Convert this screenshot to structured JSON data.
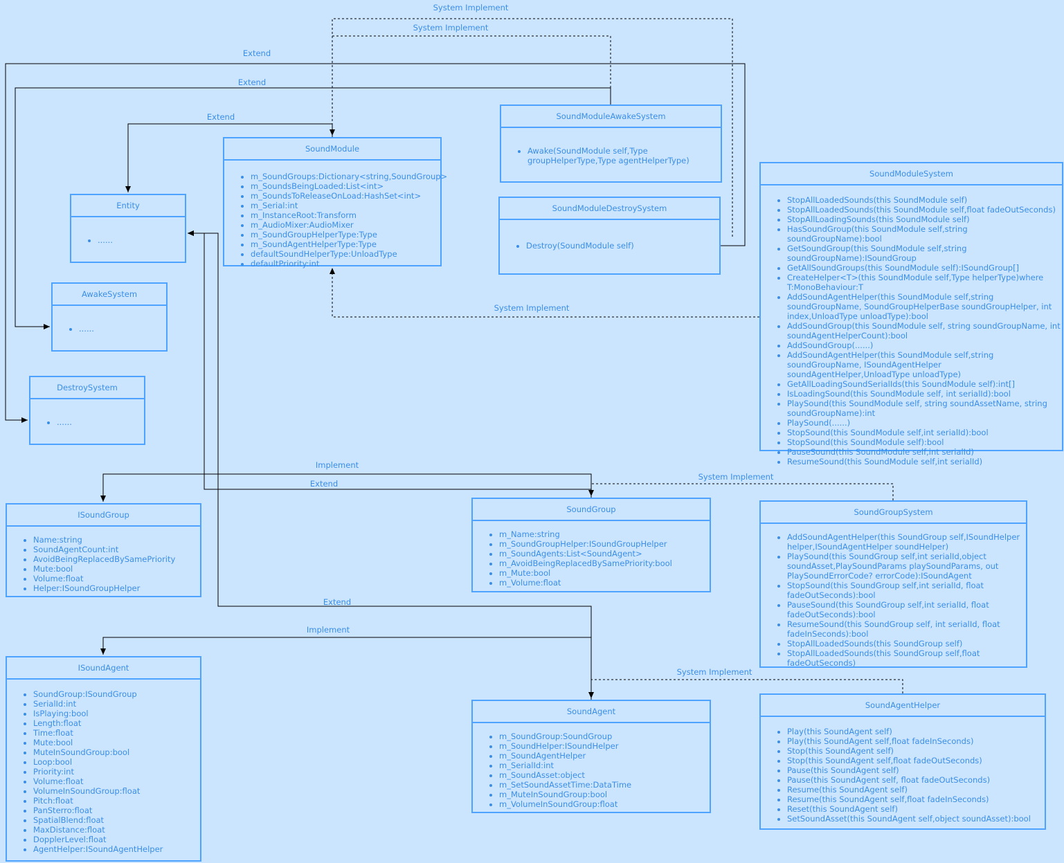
{
  "colors": {
    "background": "#cce5ff",
    "border": "#4da3ff",
    "text": "#3a8ee6",
    "line": "#000000"
  },
  "labels": {
    "destroy_sys_impl": "System Implement",
    "awake_sys_impl": "System Implement",
    "destroy_extend": "Extend",
    "awake_extend": "Extend",
    "module_extend": "Extend",
    "module_sys_impl": "System Implement",
    "group_implement": "Implement",
    "group_extend": "Extend",
    "group_sys_impl": "System Implement",
    "agent_extend": "Extend",
    "agent_implement": "Implement",
    "agent_sys_impl": "System Implement"
  },
  "classes": {
    "sound_module": {
      "title": "SoundModule",
      "items": [
        "m_SoundGroups:Dictionary<string,SoundGroup>",
        "m_SoundsBeingLoaded:List<int>",
        "m_SoundsToReleaseOnLoad:HashSet<int>",
        "m_Serial:int",
        "m_InstanceRoot:Transform",
        "m_AudioMixer:AudioMixer",
        "m_SoundGroupHelperType:Type",
        "m_SoundAgentHelperType:Type",
        "defaultSoundHelperType:UnloadType",
        "defaultPriority:int"
      ]
    },
    "entity": {
      "title": "Entity",
      "items": [
        "......"
      ]
    },
    "awake_system": {
      "title": "AwakeSystem",
      "items": [
        "......"
      ]
    },
    "destroy_system": {
      "title": "DestroySystem",
      "items": [
        "......"
      ]
    },
    "sound_module_awake_system": {
      "title": "SoundModuleAwakeSystem",
      "items": [
        "Awake(SoundModule self,Type groupHelperType,Type agentHelperType)"
      ]
    },
    "sound_module_destroy_system": {
      "title": "SoundModuleDestroySystem",
      "items": [
        "Destroy(SoundModule self)"
      ]
    },
    "sound_module_system": {
      "title": "SoundModuleSystem",
      "items": [
        "StopAllLoadedSounds(this SoundModule self)",
        "StopAllLoadedSounds(this SoundModule self,float fadeOutSeconds)",
        "StopAllLoadingSounds(this SoundModule self)",
        "HasSoundGroup(this SoundModule self,string soundGroupName):bool",
        "GetSoundGroup(this SoundModule self,string soundGroupName):ISoundGroup",
        "GetAllSoundGroups(this SoundModule self):ISoundGroup[]",
        "CreateHelper<T>(this SoundModule self,Type helperType)where T:MonoBehaviour:T",
        "AddSoundAgentHelper(this SoundModule self,string soundGroupName, SoundGroupHelperBase soundGroupHelper, int index,UnloadType unloadType):bool",
        "AddSoundGroup(this SoundModule self, string soundGroupName, int soundAgentHelperCount):bool",
        "AddSoundGroup(......)",
        "AddSoundAgentHelper(this SoundModule self,string soundGroupName, ISoundAgentHelper soundAgentHelper,UnloadType unloadType)",
        "GetAllLoadingSoundSerialIds(this SoundModule self):int[]",
        "IsLoadingSound(this SoundModule self, int serialId):bool",
        "PlaySound(this SoundModule self, string soundAssetName, string soundGroupName):int",
        "PlaySound(......)",
        "StopSound(this SoundModule self,int serialId):bool",
        "StopSound(this SoundModule self):bool",
        "PauseSound(this SoundModule self,int serialId)",
        "ResumeSound(this SoundModule self,int serialId)"
      ]
    },
    "isound_group": {
      "title": "ISoundGroup",
      "items": [
        "Name:string",
        "SoundAgentCount:int",
        "AvoidBeingReplacedBySamePriority",
        "Mute:bool",
        "Volume:float",
        "Helper:ISoundGroupHelper"
      ]
    },
    "sound_group": {
      "title": "SoundGroup",
      "items": [
        "m_Name:string",
        "m_SoundGroupHelper:ISoundGroupHelper",
        "m_SoundAgents:List<SoundAgent>",
        "m_AvoidBeingReplacedBySamePriority:bool",
        "m_Mute:bool",
        "m_Volume:float"
      ]
    },
    "sound_group_system": {
      "title": "SoundGroupSystem",
      "items": [
        "AddSoundAgentHelper(this SoundGroup self,ISoundHelper helper,ISoundAgentHelper soundHelper)",
        "PlaySound(this SoundGroup self,int serialId,object soundAsset,PlaySoundParams playSoundParams, out PlaySoundErrorCode? errorCode):ISoundAgent",
        "StopSound(this SoundGroup self,int serialId, float fadeOutSeconds):bool",
        "PauseSound(this SoundGroup self,int serialId, float fadeOutSeconds):bool",
        "ResumeSound(this SoundGroup self, int serialId, float fadeInSeconds):bool",
        "StopAllLoadedSounds(this SoundGroup self)",
        "StopAllLoadedSounds(this SoundGroup self,float fadeOutSeconds)"
      ]
    },
    "isound_agent": {
      "title": "ISoundAgent",
      "items": [
        "SoundGroup:ISoundGroup",
        "SerialId:int",
        "IsPlaying:bool",
        "Length:float",
        "Time:float",
        "Mute:bool",
        "MuteInSoundGroup:bool",
        "Loop:bool",
        "Priority:int",
        "Volume:float",
        "VolumeInSoundGroup:float",
        "Pitch:float",
        "PanSterro:float",
        "SpatialBlend:float",
        "MaxDistance:float",
        "DopplerLevel:float",
        "AgentHelper:ISoundAgentHelper"
      ]
    },
    "sound_agent": {
      "title": "SoundAgent",
      "items": [
        "m_SoundGroup:SoundGroup",
        "m_SoundHelper:ISoundHelper",
        "m_SoundAgentHelper",
        "m_SerialId:int",
        "m_SoundAsset:object",
        "m_SetSoundAssetTime:DataTime",
        "m_MuteInSoundGroup:bool",
        "m_VolumeInSoundGroup:float"
      ]
    },
    "sound_agent_helper": {
      "title": "SoundAgentHelper",
      "items": [
        "Play(this SoundAgent self)",
        "Play(this SoundAgent self,float fadeInSeconds)",
        "Stop(this SoundAgent self)",
        "Stop(this SoundAgent self,float fadeOutSeconds)",
        "Pause(this SoundAgent self)",
        "Pause(this SoundAgent self, float fadeOutSeconds)",
        "Resume(this SoundAgent self)",
        "Resume(this SoundAgent self,float fadeInSeconds)",
        "Reset(this SoundAgent self)",
        "SetSoundAsset(this SoundAgent self,object soundAsset):bool"
      ]
    }
  }
}
